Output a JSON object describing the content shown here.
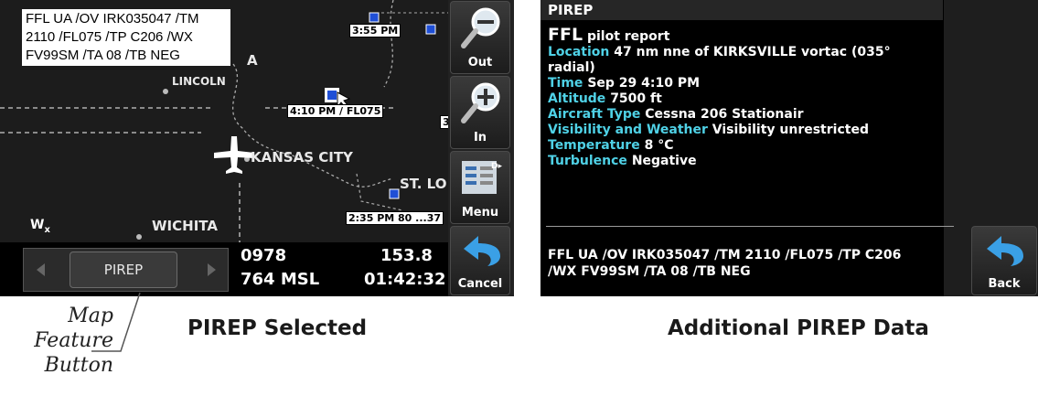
{
  "left_screen": {
    "pirep_text": [
      "FFL UA /OV IRK035047 /TM",
      "2110 /FL075 /TP C206 /WX",
      "FV99SM /TA 08 /TB NEG"
    ],
    "map": {
      "labels": [
        "LINCOLN",
        "KANSAS CITY",
        "ST. LO",
        "WICHITA",
        "A"
      ],
      "time_tags": [
        "3:55 PM",
        "4:10 PM / FL075",
        "2:35 PM 80 ...37",
        "3"
      ],
      "wx_symbol": "W",
      "wx_sub": "x"
    },
    "feature_button": {
      "label": "PIREP"
    },
    "data_fields": {
      "left_top": "0978",
      "left_bottom": "764",
      "left_bottom_unit": "MSL",
      "right_top": "153.8",
      "right_bottom": "01:42:32"
    },
    "buttons": [
      {
        "label": "Out",
        "icon": "zoom-out-icon"
      },
      {
        "label": "In",
        "icon": "zoom-in-icon"
      },
      {
        "label": "Menu",
        "icon": "menu-icon"
      },
      {
        "label": "Cancel",
        "icon": "back-arrow-icon"
      }
    ]
  },
  "right_screen": {
    "header": "PIREP",
    "report": {
      "station": "FFL",
      "title_suffix": "pilot report",
      "location_label": "Location",
      "location_value": "47 nm nne of KIRKSVILLE vortac (035° radial)",
      "time_label": "Time",
      "time_value": "Sep 29 4:10 PM",
      "altitude_label": "Altitude",
      "altitude_value": "7500 ft",
      "aircraft_label": "Aircraft Type",
      "aircraft_value": "Cessna 206 Stationair",
      "vis_label": "Visibility and Weather",
      "vis_value": "Visibility unrestricted",
      "temp_label": "Temperature",
      "temp_value": "8 °C",
      "turb_label": "Turbulence",
      "turb_value": "Negative"
    },
    "raw_lines": [
      "FFL UA /OV IRK035047 /TM 2110 /FL075 /TP C206",
      "/WX FV99SM /TA 08 /TB NEG"
    ],
    "back_button": "Back"
  },
  "captions": {
    "left": "PIREP Selected",
    "right": "Additional PIREP Data",
    "callout": [
      "Map",
      "Feature",
      "Button"
    ]
  },
  "colors": {
    "field_label": "#4fd1e6",
    "button_arrow": "#3aa0e6"
  }
}
